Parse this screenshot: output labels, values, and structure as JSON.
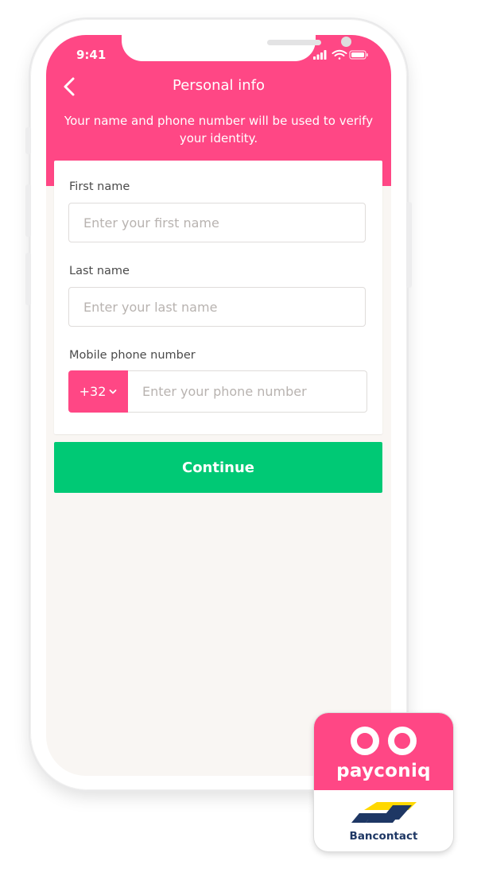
{
  "status_bar": {
    "time": "9:41"
  },
  "header": {
    "title": "Personal info",
    "subtitle": "Your name and phone number will be used to verify your identity."
  },
  "form": {
    "first_name": {
      "label": "First name",
      "placeholder": "Enter your first name",
      "value": ""
    },
    "last_name": {
      "label": "Last name",
      "placeholder": "Enter your last name",
      "value": ""
    },
    "phone": {
      "label": "Mobile phone number",
      "country_code": "+32",
      "placeholder": "Enter your phone number",
      "value": ""
    }
  },
  "continue_label": "Continue",
  "badge": {
    "brand": "payconiq",
    "sub_brand": "Bancontact"
  },
  "colors": {
    "accent": "#ff4785",
    "button": "#00c975",
    "background": "#f9f6f3",
    "bancontact_blue": "#1e3764",
    "bancontact_yellow": "#ffd800"
  },
  "icons": [
    "back-chevron-icon",
    "signal-icon",
    "wifi-icon",
    "battery-icon",
    "chevron-down-icon",
    "payconiq-logo-icon",
    "bancontact-logo-icon"
  ]
}
